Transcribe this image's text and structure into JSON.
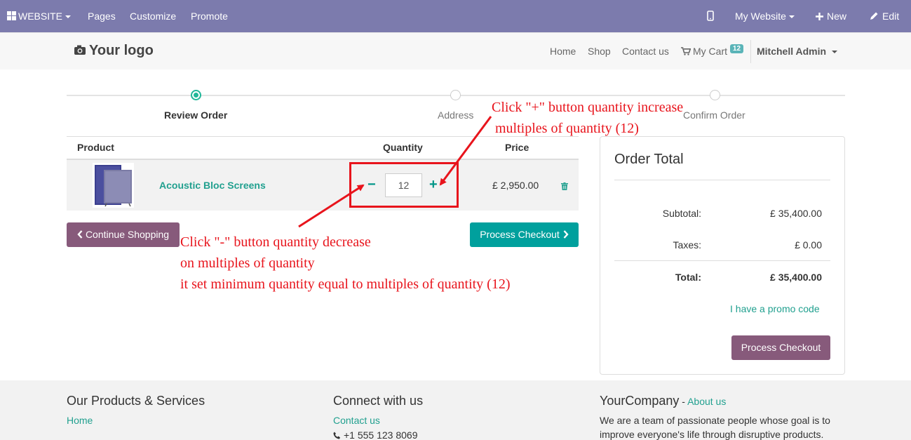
{
  "adminbar": {
    "website": "WEBSITE",
    "pages": "Pages",
    "customize": "Customize",
    "promote": "Promote",
    "my_website": "My Website",
    "new": "New",
    "edit": "Edit"
  },
  "header": {
    "logo": "Your logo",
    "nav": [
      "Home",
      "Shop",
      "Contact us"
    ],
    "cart_label": "My Cart",
    "cart_count": "12",
    "user": "Mitchell Admin"
  },
  "wizard": {
    "steps": [
      "Review Order",
      "Address",
      "Confirm Order"
    ],
    "active_step": 0
  },
  "cart": {
    "headers": {
      "product": "Product",
      "quantity": "Quantity",
      "price": "Price"
    },
    "rows": [
      {
        "product": "Acoustic Bloc Screens",
        "quantity": "12",
        "price": "£ 2,950.00"
      }
    ],
    "minus": "−",
    "plus": "+",
    "continue_label": "Continue Shopping",
    "checkout_label": "Process Checkout"
  },
  "order_total": {
    "title": "Order Total",
    "subtotal_label": "Subtotal:",
    "subtotal": "£ 35,400.00",
    "taxes_label": "Taxes:",
    "taxes": "£ 0.00",
    "total_label": "Total:",
    "total": "£ 35,400.00",
    "promo": "I have a promo code",
    "checkout_label": "Process Checkout"
  },
  "footer": {
    "col1_title": "Our Products & Services",
    "col1_link": "Home",
    "col2_title": "Connect with us",
    "col2_link": "Contact us",
    "col2_phone": "+1 555 123 8069",
    "col3_title": "YourCompany",
    "col3_link": "About us",
    "col3_text1": "We are a team of passionate people whose goal is to",
    "col3_text2": "improve everyone's life through disruptive products."
  },
  "annotations": {
    "plus_line1": "Click \"+\" button quantity increase",
    "plus_line2": "multiples of quantity (12)",
    "minus_line1": "Click \"-\" button quantity decrease",
    "minus_line2": "on multiples of quantity",
    "minus_line3": "it set minimum quantity equal to multiples of quantity (12)"
  },
  "colors": {
    "adminbar": "#7c7bad",
    "accent_teal": "#00a09d",
    "accent_purple": "#875a7b",
    "annotation_red": "#e8141c"
  }
}
